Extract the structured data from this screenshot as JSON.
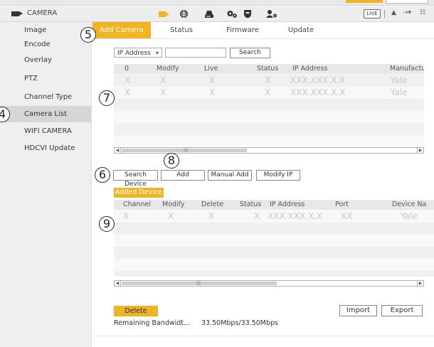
{
  "app": {
    "title": "CAMERA",
    "live_label": "LIVE"
  },
  "toolbar_icons": [
    "camera-icon",
    "network-icon",
    "storage-icon",
    "settings-icon",
    "shield-icon",
    "account-icon"
  ],
  "user_icons": [
    "user-icon",
    "logout-icon",
    "menu-icon"
  ],
  "sidebar": {
    "items": [
      {
        "label": "Image"
      },
      {
        "label": "Encode"
      },
      {
        "label": "Overlay"
      },
      {
        "label": "PTZ"
      },
      {
        "label": "Channel Type"
      },
      {
        "label": "Camera List"
      },
      {
        "label": "WIFI CAMERA"
      },
      {
        "label": "HDCVI Update"
      }
    ],
    "active_index": 5
  },
  "tabs": [
    {
      "label": "Add Camera"
    },
    {
      "label": "Status"
    },
    {
      "label": "Firmware"
    },
    {
      "label": "Update"
    }
  ],
  "search": {
    "type_value": "IP Address",
    "search_label": "Search"
  },
  "device_table": {
    "columns": [
      "0",
      "Modify",
      "Live",
      "Status",
      "IP Address",
      "Manufactu"
    ],
    "rows": [
      [
        "X",
        "X",
        "X",
        "X",
        "XXX.XXX.X.X",
        "Yale"
      ],
      [
        "X",
        "X",
        "X",
        "X",
        "XXX.XXX.X.X",
        "Yale"
      ]
    ]
  },
  "actions": {
    "search_device": "Search Device",
    "add": "Add",
    "manual_add": "Manual Add",
    "modify_ip": "Modify IP"
  },
  "added_device": {
    "label": "Added Device",
    "columns": [
      "Channel",
      "Modify",
      "Delete",
      "Status",
      "IP Address",
      "Port",
      "Device Na"
    ],
    "rows": [
      [
        "X",
        "X",
        "X",
        "X",
        "XXX.XXX.X.X",
        "XX",
        "Yale"
      ]
    ]
  },
  "footer": {
    "delete": "Delete",
    "import": "Import",
    "export": "Export",
    "bandwidth_label": "Remaining Bandwidt...",
    "bandwidth_value": "33.50Mbps/33.50Mbps"
  },
  "callouts": [
    "4",
    "5",
    "6",
    "7",
    "8",
    "9"
  ],
  "colors": {
    "accent": "#f0b323",
    "sidebar_bg": "#efefef",
    "active_item": "#d6d6d6",
    "placeholder_text": "#c8c8c8"
  }
}
